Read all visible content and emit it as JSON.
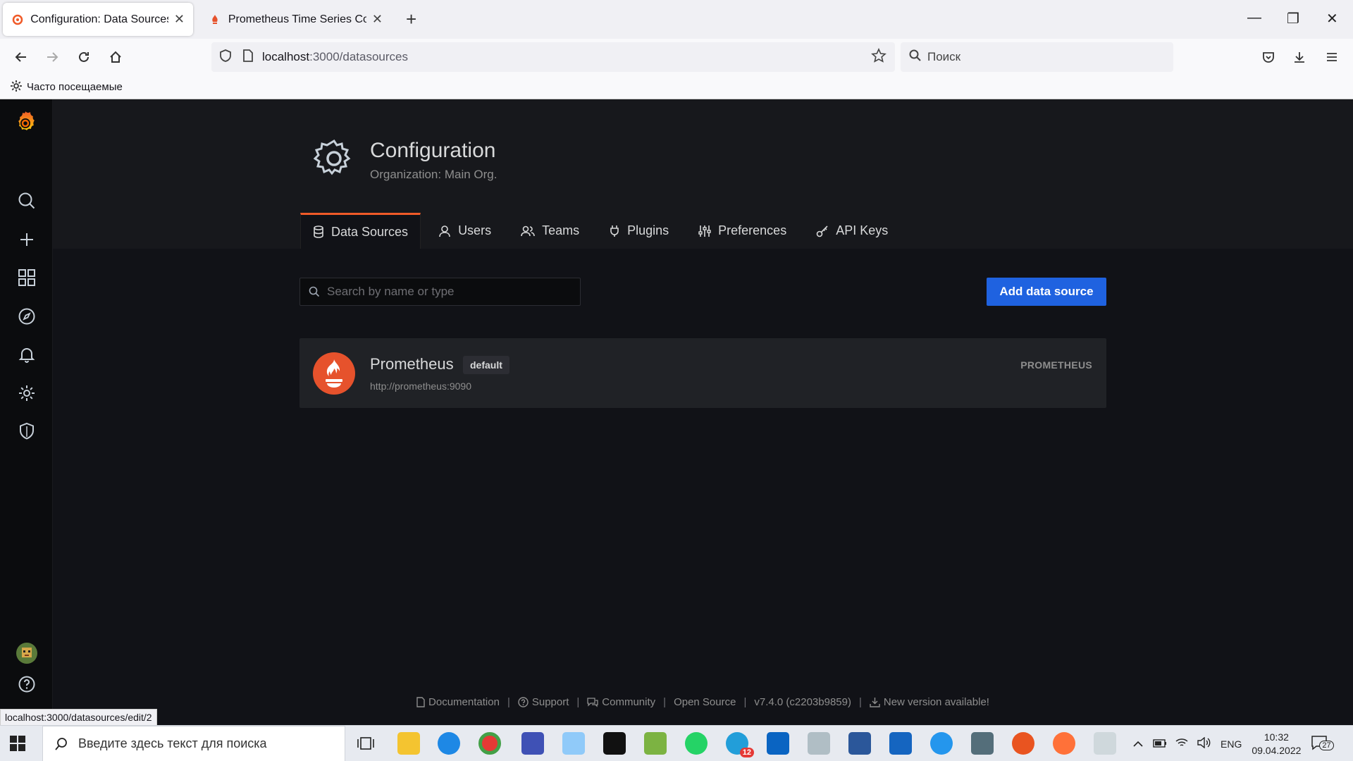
{
  "browser": {
    "tabs": [
      {
        "title": "Configuration: Data Sources - G",
        "active": true
      },
      {
        "title": "Prometheus Time Series Collect",
        "active": false
      }
    ],
    "url_host": "localhost",
    "url_path": ":3000/datasources",
    "search_placeholder": "Поиск",
    "bookmark_label": "Часто посещаемые",
    "status_url": "localhost:3000/datasources/edit/2"
  },
  "page": {
    "title": "Configuration",
    "subtitle": "Organization: Main Org.",
    "tabs": [
      {
        "label": "Data Sources",
        "icon": "database-icon",
        "active": true
      },
      {
        "label": "Users",
        "icon": "user-icon",
        "active": false
      },
      {
        "label": "Teams",
        "icon": "users-icon",
        "active": false
      },
      {
        "label": "Plugins",
        "icon": "plug-icon",
        "active": false
      },
      {
        "label": "Preferences",
        "icon": "sliders-icon",
        "active": false
      },
      {
        "label": "API Keys",
        "icon": "key-icon",
        "active": false
      }
    ],
    "search_placeholder": "Search by name or type",
    "add_button_label": "Add data source",
    "datasource": {
      "name": "Prometheus",
      "badge": "default",
      "url": "http://prometheus:9090",
      "type": "PROMETHEUS"
    },
    "footer": {
      "documentation": "Documentation",
      "support": "Support",
      "community": "Community",
      "open_source": "Open Source",
      "version": "v7.4.0 (c2203b9859)",
      "new_version": "New version available!",
      "separator": "|"
    }
  },
  "taskbar": {
    "search_placeholder": "Введите здесь текст для поиска",
    "language": "ENG",
    "time": "10:32",
    "date": "09.04.2022",
    "notification_count": "27",
    "telegram_badge": "12"
  },
  "colors": {
    "accent": "#f05a28",
    "primary_button": "#1f62e0",
    "page_bg": "#111217",
    "header_bg": "#17181c"
  }
}
